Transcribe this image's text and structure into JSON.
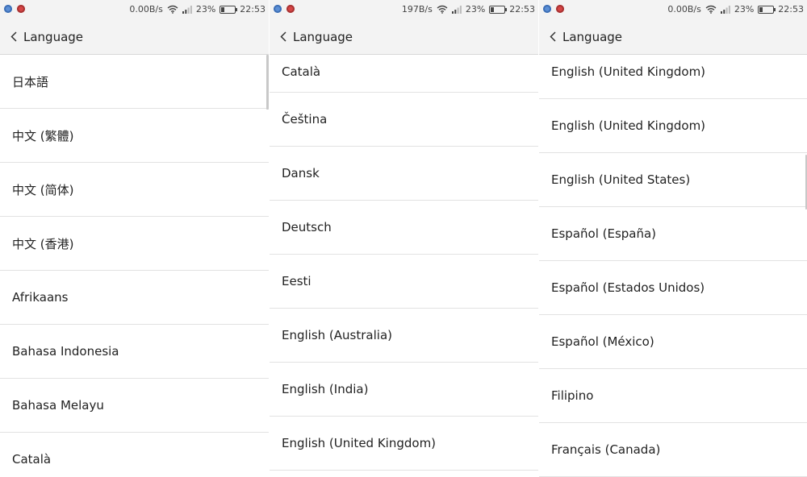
{
  "panels": [
    {
      "status": {
        "speed": "0.00B/s",
        "battery": "23%",
        "battery_level": 0.23,
        "time": "22:53"
      },
      "header": {
        "title": "Language"
      },
      "languages": [
        "日本語",
        "中文 (繁體)",
        "中文 (简体)",
        "中文 (香港)",
        "Afrikaans",
        "Bahasa Indonesia",
        "Bahasa Melayu",
        "Català"
      ]
    },
    {
      "status": {
        "speed": "197B/s",
        "battery": "23%",
        "battery_level": 0.23,
        "time": "22:53"
      },
      "header": {
        "title": "Language"
      },
      "languages": [
        "Català",
        "Čeština",
        "Dansk",
        "Deutsch",
        "Eesti",
        "English (Australia)",
        "English (India)",
        "English (United Kingdom)"
      ]
    },
    {
      "status": {
        "speed": "0.00B/s",
        "battery": "23%",
        "battery_level": 0.23,
        "time": "22:53"
      },
      "header": {
        "title": "Language"
      },
      "languages": [
        "English (United Kingdom)",
        "English (United Kingdom)",
        "English (United States)",
        "Español (España)",
        "Español (Estados Unidos)",
        "Español (México)",
        "Filipino",
        "Français (Canada)"
      ]
    }
  ],
  "colors": {
    "status_bg": "#f3f3f3",
    "divider": "#e2e2e2",
    "text": "#222222"
  },
  "icons": {
    "back": "chevron-left-icon",
    "wifi": "wifi-icon",
    "signal": "signal-icon",
    "battery": "battery-icon"
  }
}
